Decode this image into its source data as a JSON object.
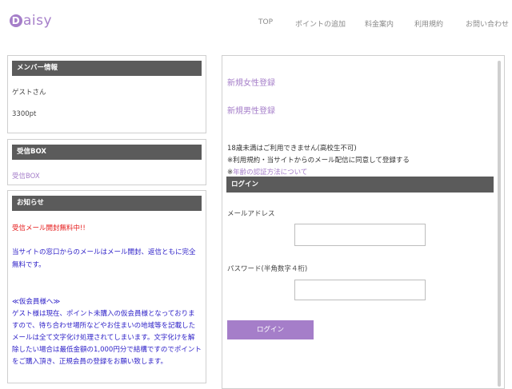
{
  "brand": {
    "logo_letter": "D",
    "logo_rest": "aisy",
    "logo_color": "#a57ec9"
  },
  "nav": [
    {
      "label": "TOP"
    },
    {
      "label": "ポイントの追加"
    },
    {
      "label": "料金案内"
    },
    {
      "label": "利用規約"
    },
    {
      "label": "お問い合わせ"
    }
  ],
  "member": {
    "header": "メンバー情報",
    "name": "ゲストさん",
    "points": "3300pt"
  },
  "inbox": {
    "header": "受信BOX",
    "link": "受信BOX"
  },
  "notice": {
    "header": "お知らせ",
    "line_red": "受信メール開封無料中!!",
    "para1": [
      "当サイトの窓口からのメールはメール開封、返信ともに完全",
      "無料です。"
    ],
    "guest_title": "≪仮会員様へ≫",
    "para2": [
      "ゲスト様は現在、ポイント未購入の仮会員様となっておりま",
      "すので、待ち合わせ場所などやお住まいの地域等を記載した",
      "メールは全て文字化け処理されてしまいます。文字化けを解",
      "除したい場合は最低金額の1,000円分で結構ですのでポイント",
      "をご購入頂き、正規会員の登録をお願い致します。"
    ]
  },
  "register": {
    "female_link": "新規女性登録",
    "male_link": "新規男性登録",
    "age_notice": "18歳未満はご利用できません(高校生不可)",
    "terms_notice": "※利用規約・当サイトからのメール配信に同意して登録する",
    "age_verify_prefix": "※",
    "age_verify_link": "年齢の認証方法について"
  },
  "login": {
    "header": "ログイン",
    "email_label": "メールアドレス",
    "email_value": "",
    "password_label": "パスワード(半角数字４桁)",
    "password_value": "",
    "button_label": "ログイン"
  },
  "colors": {
    "accent": "#a57ec9",
    "header_bar": "#5b5b5b",
    "notice_red": "#e51919",
    "notice_blue": "#2f22c8"
  }
}
